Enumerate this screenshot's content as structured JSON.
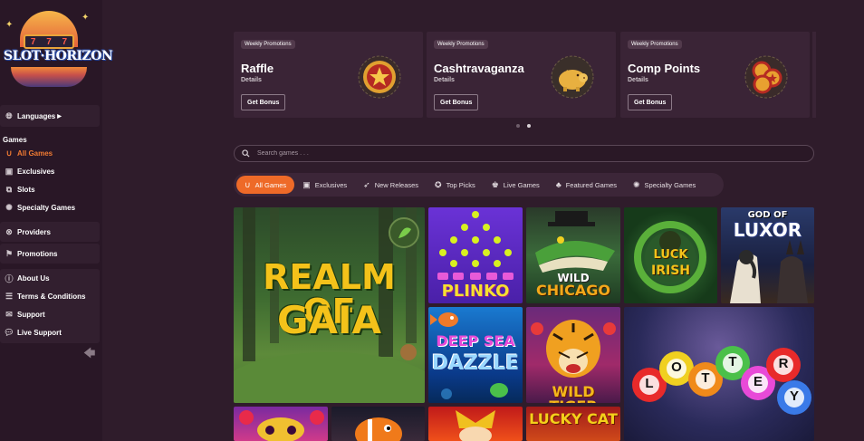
{
  "brand": {
    "name": "SLOT·HORIZON"
  },
  "sidebar": {
    "languages": "Languages",
    "games_heading": "Games",
    "games": [
      {
        "label": "All Games",
        "icon": "horseshoe-icon"
      },
      {
        "label": "Exclusives",
        "icon": "exclusive-icon"
      },
      {
        "label": "Slots",
        "icon": "slots-icon"
      },
      {
        "label": "Specialty Games",
        "icon": "specialty-icon"
      }
    ],
    "providers": "Providers",
    "promotions": "Promotions",
    "info": [
      {
        "label": "About Us",
        "icon": "info-icon"
      },
      {
        "label": "Terms & Conditions",
        "icon": "document-icon"
      },
      {
        "label": "Support",
        "icon": "mail-icon"
      },
      {
        "label": "Live Support",
        "icon": "chat-icon"
      }
    ]
  },
  "promotions": [
    {
      "tag": "Weekly Promotions",
      "title": "Raffle",
      "details": "Details",
      "button": "Get Bonus",
      "icon": "raffle-star-icon"
    },
    {
      "tag": "Weekly Promotions",
      "title": "Cashtravaganza",
      "details": "Details",
      "button": "Get Bonus",
      "icon": "piggy-bank-icon"
    },
    {
      "tag": "Weekly Promotions",
      "title": "Comp Points",
      "details": "Details",
      "button": "Get Bonus",
      "icon": "coins-icon"
    }
  ],
  "search": {
    "placeholder": "Search games . . ."
  },
  "tabs": [
    {
      "label": "All Games",
      "active": true
    },
    {
      "label": "Exclusives"
    },
    {
      "label": "New Releases"
    },
    {
      "label": "Top Picks"
    },
    {
      "label": "Live Games"
    },
    {
      "label": "Featured Games"
    },
    {
      "label": "Specialty Games"
    }
  ],
  "games": {
    "realm": {
      "line1": "REALM OF",
      "line2": "GAIA"
    },
    "plinko": "PLINKO",
    "chicago": {
      "line1": "WILD",
      "line2": "CHICAGO"
    },
    "irish": {
      "line1": "LUCK",
      "line2": "IRISH"
    },
    "luxor": {
      "line1": "GOD OF",
      "line2": "LUXOR"
    },
    "deepsea": {
      "line1": "DEEP SEA",
      "line2": "DAZZLE"
    },
    "tiger": "WILD TIGER",
    "lottery": [
      "L",
      "O",
      "T",
      "T",
      "E",
      "R",
      "Y"
    ],
    "lucky": "LUCKY CAT"
  },
  "colors": {
    "accent": "#ee6a28",
    "sidebar_bg": "#291726",
    "page_bg": "#2f1c2b"
  }
}
